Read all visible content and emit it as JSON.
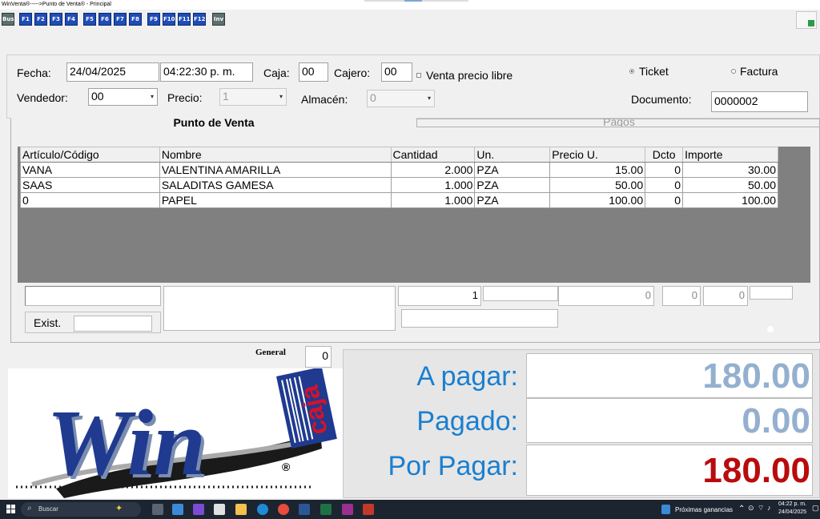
{
  "window": {
    "title": "WinVenta®----->Punto de Venta® - Principal"
  },
  "toolbar": {
    "buttons": [
      {
        "label": "Bus",
        "icon": "search-icon"
      },
      {
        "label": "F1"
      },
      {
        "label": "F2"
      },
      {
        "label": "F3"
      },
      {
        "label": "F4"
      },
      {
        "label": "F5"
      },
      {
        "label": "F6"
      },
      {
        "label": "F7"
      },
      {
        "label": "F8"
      },
      {
        "label": "F9"
      },
      {
        "label": "F10"
      },
      {
        "label": "F11"
      },
      {
        "label": "F12"
      },
      {
        "label": "Inv",
        "icon": "inventory-icon"
      }
    ]
  },
  "header": {
    "fecha_label": "Fecha:",
    "fecha_value": "24/04/2025",
    "hora_value": "04:22:30 p. m.",
    "caja_label": "Caja:",
    "caja_value": "00",
    "cajero_label": "Cajero:",
    "cajero_value": "00",
    "venta_libre_label": "Venta  precio libre",
    "vendedor_label": "Vendedor:",
    "vendedor_value": "00",
    "precio_label": "Precio:",
    "precio_value": "1",
    "almacen_label": "Almacén:",
    "almacen_value": "0",
    "ticket_label": "Ticket",
    "factura_label": "Factura",
    "documento_label": "Documento:",
    "documento_value": "0000002",
    "selected_doc_type": "Ticket"
  },
  "tabs": [
    {
      "label": "Punto de Venta",
      "active": true
    },
    {
      "label": "Pagos",
      "active": false
    }
  ],
  "table": {
    "columns": [
      "Artículo/Código",
      "Nombre",
      "Cantidad",
      "Un.",
      "Precio U.",
      "Dcto",
      "Importe"
    ],
    "rows": [
      [
        "VANA",
        "VALENTINA AMARILLA",
        "2.000",
        "PZA",
        "15.00",
        "0",
        "30.00"
      ],
      [
        "SAAS",
        "SALADITAS GAMESA",
        "1.000",
        "PZA",
        "50.00",
        "0",
        "50.00"
      ],
      [
        "0",
        "PAPEL",
        "1.000",
        "PZA",
        "100.00",
        "0",
        "100.00"
      ]
    ]
  },
  "entry": {
    "cantidad": "1",
    "precio": "0",
    "dcto": "0",
    "importe": "0",
    "exist_label": "Exist."
  },
  "general": {
    "label": "General",
    "value": "0"
  },
  "logo": {
    "text": "Win",
    "tag": "caja",
    "registered": "®"
  },
  "totals": {
    "a_pagar_label": "A pagar:",
    "a_pagar_value": "180.00",
    "pagado_label": "Pagado:",
    "pagado_value": "0.00",
    "por_pagar_label": "Por Pagar:",
    "por_pagar_value": "180.00",
    "colors": {
      "label": "#1a7fd0",
      "a_pagar": "#94b0cf",
      "pagado": "#94b0cf",
      "por_pagar": "#b80c0c"
    }
  },
  "taskbar": {
    "search_placeholder": "Buscar",
    "news": "Próximas ganancias",
    "time": "04:22 p. m.",
    "date": "24/04/2025"
  }
}
